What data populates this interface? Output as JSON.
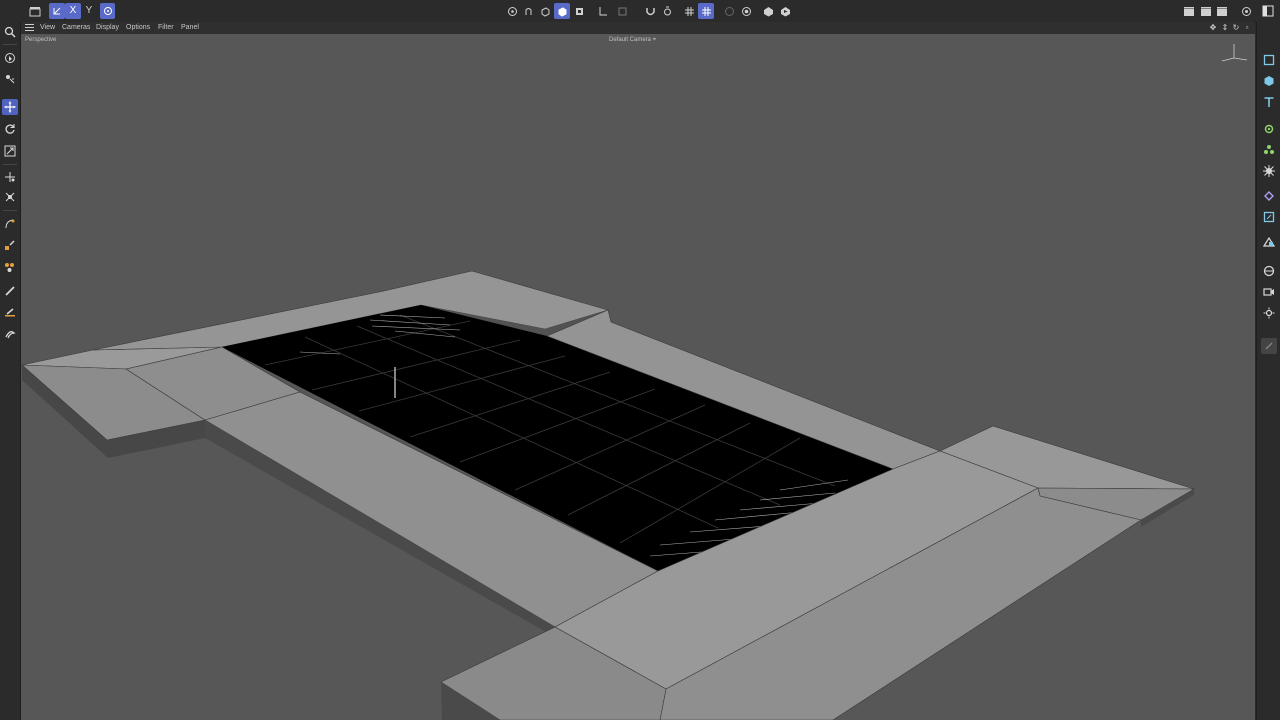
{
  "viewport": {
    "menu": [
      "View",
      "Cameras",
      "Display",
      "Options",
      "Filter",
      "Panel"
    ],
    "projection_label": "Perspective",
    "camera_label": "Default Camera"
  },
  "toolbar": {
    "axis_x": "X",
    "axis_y": "Y",
    "axis_z": "Z"
  },
  "colors": {
    "accent": "#5a6ac8",
    "viewport_bg": "#575757",
    "mesh_face": "#8f8f8f",
    "water": "#000000",
    "right_tool_icons": "#7fc9e6"
  },
  "icons": {
    "top_left": [
      "clapper-icon",
      "world-coords-icon",
      "axis-x-icon",
      "axis-y-icon",
      "axis-z-icon",
      "coord-system-icon"
    ],
    "top_center": [
      "model-mode-icon",
      "point-mode-icon",
      "edge-mode-icon",
      "polygon-mode-icon",
      "uv-mode-icon",
      "axis-mode-icon",
      "solo-icon",
      "magnet-icon",
      "snap-icon",
      "grid-snap-icon",
      "workplane-icon",
      "render-view-icon",
      "render-settings-icon",
      "render-region-icon"
    ],
    "top_right": [
      "render-icon",
      "render-queue-icon",
      "picture-viewer-icon",
      "undo-icon",
      "refresh-icon",
      "layout-icon"
    ],
    "left": [
      "search-icon",
      "live-select-icon",
      "rotate-view-icon",
      "move-icon",
      "rotate-icon",
      "scale-icon",
      "transfer-icon",
      "snap-icon",
      "knife-icon",
      "paint-icon",
      "brush-icon",
      "spline-pen-icon",
      "cloth-icon",
      "sculpt-icon"
    ],
    "right": [
      "panel-icon",
      "cube-icon",
      "sphere-icon",
      "text-icon",
      "generator-icon",
      "cloner-icon",
      "deformer-icon",
      "field-icon",
      "tag-icon",
      "scene-icon",
      "camera-icon",
      "light-icon",
      "material-icon",
      "edit-icon"
    ]
  }
}
